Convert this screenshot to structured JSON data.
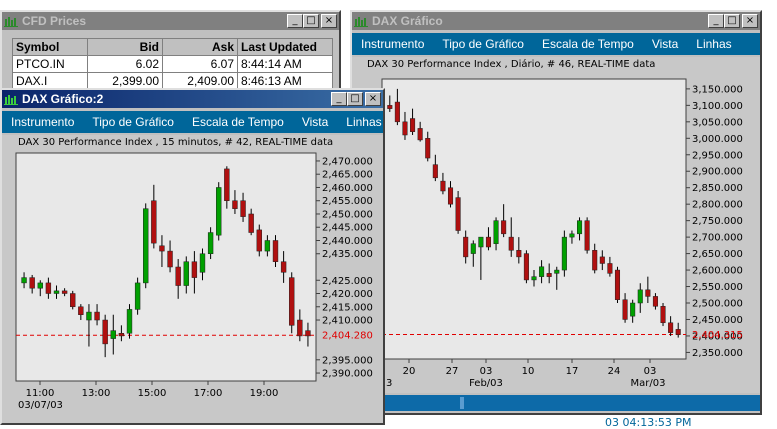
{
  "cfd_window": {
    "title": "CFD Prices",
    "columns": [
      "Symbol",
      "Bid",
      "Ask",
      "Last Updated"
    ],
    "rows": [
      [
        "PTCO.IN",
        "6.02",
        "6.07",
        "8:44:14 AM"
      ],
      [
        "DAX.I",
        "2,399.00",
        "2,409.00",
        "8:46:13 AM"
      ]
    ]
  },
  "window_buttons": {
    "minimize": "_",
    "maximize": "□",
    "close": "×"
  },
  "daily_window": {
    "title": "DAX Gráfico",
    "menu": [
      "Instrumento",
      "Tipo de Gráfico",
      "Escala de Tempo",
      "Vista",
      "Linhas"
    ],
    "subtitle": "DAX 30 Performance Index , Diário, # 46, REAL-TIME data",
    "current_price_label": "2,404.315",
    "y_tick_labels": [
      "3,150.000",
      "3,100.000",
      "3,050.000",
      "3,000.000",
      "2,950.000",
      "2,900.000",
      "2,850.000",
      "2,800.000",
      "2,750.000",
      "2,700.000",
      "2,650.000",
      "2,600.000",
      "2,550.000",
      "2,500.000",
      "2,450.000",
      "2,400.000",
      "2,350.000"
    ],
    "x_tick_labels": [
      "20",
      "27",
      "03",
      "10",
      "17",
      "24",
      "03"
    ],
    "x_sub_labels": [
      "3",
      "Feb/03",
      "Mar/03"
    ]
  },
  "intraday_window": {
    "title": "DAX Gráfico:2",
    "menu": [
      "Instrumento",
      "Tipo de Gráfico",
      "Escala de Tempo",
      "Vista",
      "Linhas"
    ],
    "subtitle": "DAX 30 Performance Index , 15 minutos, # 42, REAL-TIME data",
    "current_price_label": "2,404.280",
    "y_tick_labels": [
      "2,470.000",
      "2,465.000",
      "2,460.000",
      "2,455.000",
      "2,450.000",
      "2,445.000",
      "2,440.000",
      "2,435.000",
      "2,425.000",
      "2,420.000",
      "2,415.000",
      "2,410.000",
      "2,395.000",
      "2,390.000"
    ],
    "x_tick_labels": [
      "11:00",
      "13:00",
      "15:00",
      "17:00",
      "19:00"
    ],
    "date_label": "03/07/03"
  },
  "bottom_status": "03   04:13:53 PM",
  "colors": {
    "up": "#00a000",
    "down": "#b01010",
    "menubar": "#00669a",
    "price_line": "#e00000",
    "scrollbar": "#0d6aa8"
  },
  "chart_data": [
    {
      "type": "candlestick",
      "title": "DAX 30 Performance Index , Diário, # 46, REAL-TIME data",
      "ylim": [
        2330,
        3180
      ],
      "current_price": 2404.315,
      "x_ticks": [
        "20",
        "27",
        "03",
        "10",
        "17",
        "24",
        "03"
      ],
      "candles": [
        {
          "o": 3100,
          "h": 3130,
          "l": 3080,
          "c": 3090
        },
        {
          "o": 3110,
          "h": 3150,
          "l": 3040,
          "c": 3050
        },
        {
          "o": 3050,
          "h": 3080,
          "l": 2995,
          "c": 3010
        },
        {
          "o": 3060,
          "h": 3090,
          "l": 3010,
          "c": 3020
        },
        {
          "o": 3030,
          "h": 3050,
          "l": 2990,
          "c": 2995
        },
        {
          "o": 3000,
          "h": 3020,
          "l": 2930,
          "c": 2940
        },
        {
          "o": 2920,
          "h": 2950,
          "l": 2870,
          "c": 2880
        },
        {
          "o": 2870,
          "h": 2895,
          "l": 2830,
          "c": 2840
        },
        {
          "o": 2850,
          "h": 2870,
          "l": 2790,
          "c": 2800
        },
        {
          "o": 2820,
          "h": 2840,
          "l": 2710,
          "c": 2720
        },
        {
          "o": 2700,
          "h": 2720,
          "l": 2620,
          "c": 2640
        },
        {
          "o": 2650,
          "h": 2690,
          "l": 2610,
          "c": 2680
        },
        {
          "o": 2670,
          "h": 2690,
          "l": 2570,
          "c": 2700
        },
        {
          "o": 2700,
          "h": 2730,
          "l": 2660,
          "c": 2670
        },
        {
          "o": 2680,
          "h": 2760,
          "l": 2660,
          "c": 2750
        },
        {
          "o": 2750,
          "h": 2800,
          "l": 2700,
          "c": 2710
        },
        {
          "o": 2700,
          "h": 2760,
          "l": 2640,
          "c": 2660
        },
        {
          "o": 2660,
          "h": 2700,
          "l": 2620,
          "c": 2640
        },
        {
          "o": 2650,
          "h": 2660,
          "l": 2560,
          "c": 2570
        },
        {
          "o": 2570,
          "h": 2600,
          "l": 2550,
          "c": 2580
        },
        {
          "o": 2580,
          "h": 2630,
          "l": 2560,
          "c": 2610
        },
        {
          "o": 2590,
          "h": 2620,
          "l": 2560,
          "c": 2580
        },
        {
          "o": 2590,
          "h": 2610,
          "l": 2540,
          "c": 2600
        },
        {
          "o": 2600,
          "h": 2720,
          "l": 2580,
          "c": 2700
        },
        {
          "o": 2700,
          "h": 2720,
          "l": 2680,
          "c": 2710
        },
        {
          "o": 2710,
          "h": 2760,
          "l": 2690,
          "c": 2750
        },
        {
          "o": 2750,
          "h": 2760,
          "l": 2650,
          "c": 2660
        },
        {
          "o": 2660,
          "h": 2680,
          "l": 2590,
          "c": 2600
        },
        {
          "o": 2640,
          "h": 2660,
          "l": 2600,
          "c": 2620
        },
        {
          "o": 2620,
          "h": 2640,
          "l": 2580,
          "c": 2590
        },
        {
          "o": 2600,
          "h": 2610,
          "l": 2500,
          "c": 2510
        },
        {
          "o": 2510,
          "h": 2530,
          "l": 2440,
          "c": 2450
        },
        {
          "o": 2460,
          "h": 2510,
          "l": 2440,
          "c": 2500
        },
        {
          "o": 2500,
          "h": 2560,
          "l": 2470,
          "c": 2540
        },
        {
          "o": 2540,
          "h": 2580,
          "l": 2500,
          "c": 2520
        },
        {
          "o": 2520,
          "h": 2530,
          "l": 2480,
          "c": 2490
        },
        {
          "o": 2490,
          "h": 2500,
          "l": 2430,
          "c": 2440
        },
        {
          "o": 2440,
          "h": 2460,
          "l": 2400,
          "c": 2410
        },
        {
          "o": 2420,
          "h": 2440,
          "l": 2395,
          "c": 2404
        }
      ]
    },
    {
      "type": "candlestick",
      "title": "DAX 30 Performance Index , 15 minutos, # 42, REAL-TIME data",
      "ylim": [
        2387,
        2473
      ],
      "current_price": 2404.28,
      "x_ticks": [
        "11:00",
        "13:00",
        "15:00",
        "17:00",
        "19:00"
      ],
      "candles": [
        {
          "o": 2424,
          "h": 2428,
          "l": 2422,
          "c": 2426
        },
        {
          "o": 2426,
          "h": 2427,
          "l": 2420,
          "c": 2422
        },
        {
          "o": 2422,
          "h": 2425,
          "l": 2419,
          "c": 2424
        },
        {
          "o": 2424,
          "h": 2426,
          "l": 2418,
          "c": 2420
        },
        {
          "o": 2420,
          "h": 2423,
          "l": 2418,
          "c": 2421
        },
        {
          "o": 2421,
          "h": 2422,
          "l": 2419,
          "c": 2420
        },
        {
          "o": 2420,
          "h": 2421,
          "l": 2414,
          "c": 2415
        },
        {
          "o": 2415,
          "h": 2416,
          "l": 2410,
          "c": 2412
        },
        {
          "o": 2410,
          "h": 2416,
          "l": 2400,
          "c": 2413
        },
        {
          "o": 2413,
          "h": 2416,
          "l": 2408,
          "c": 2410
        },
        {
          "o": 2410,
          "h": 2412,
          "l": 2396,
          "c": 2401
        },
        {
          "o": 2403,
          "h": 2412,
          "l": 2397,
          "c": 2406
        },
        {
          "o": 2405,
          "h": 2408,
          "l": 2402,
          "c": 2404
        },
        {
          "o": 2405,
          "h": 2416,
          "l": 2403,
          "c": 2414
        },
        {
          "o": 2414,
          "h": 2426,
          "l": 2412,
          "c": 2424
        },
        {
          "o": 2424,
          "h": 2454,
          "l": 2422,
          "c": 2452
        },
        {
          "o": 2455,
          "h": 2461,
          "l": 2437,
          "c": 2439
        },
        {
          "o": 2438,
          "h": 2442,
          "l": 2430,
          "c": 2436
        },
        {
          "o": 2436,
          "h": 2440,
          "l": 2428,
          "c": 2430
        },
        {
          "o": 2430,
          "h": 2433,
          "l": 2418,
          "c": 2423
        },
        {
          "o": 2423,
          "h": 2434,
          "l": 2420,
          "c": 2432
        },
        {
          "o": 2432,
          "h": 2436,
          "l": 2420,
          "c": 2426
        },
        {
          "o": 2428,
          "h": 2437,
          "l": 2425,
          "c": 2435
        },
        {
          "o": 2435,
          "h": 2445,
          "l": 2433,
          "c": 2443
        },
        {
          "o": 2442,
          "h": 2462,
          "l": 2440,
          "c": 2460
        },
        {
          "o": 2467,
          "h": 2468,
          "l": 2452,
          "c": 2455
        },
        {
          "o": 2455,
          "h": 2459,
          "l": 2450,
          "c": 2452
        },
        {
          "o": 2455,
          "h": 2458,
          "l": 2447,
          "c": 2449
        },
        {
          "o": 2450,
          "h": 2452,
          "l": 2442,
          "c": 2443
        },
        {
          "o": 2444,
          "h": 2446,
          "l": 2434,
          "c": 2436
        },
        {
          "o": 2436,
          "h": 2442,
          "l": 2434,
          "c": 2440
        },
        {
          "o": 2440,
          "h": 2442,
          "l": 2430,
          "c": 2432
        },
        {
          "o": 2432,
          "h": 2436,
          "l": 2424,
          "c": 2428
        },
        {
          "o": 2426,
          "h": 2428,
          "l": 2405,
          "c": 2408
        },
        {
          "o": 2410,
          "h": 2414,
          "l": 2402,
          "c": 2404
        },
        {
          "o": 2406,
          "h": 2409,
          "l": 2400,
          "c": 2404
        }
      ]
    }
  ]
}
